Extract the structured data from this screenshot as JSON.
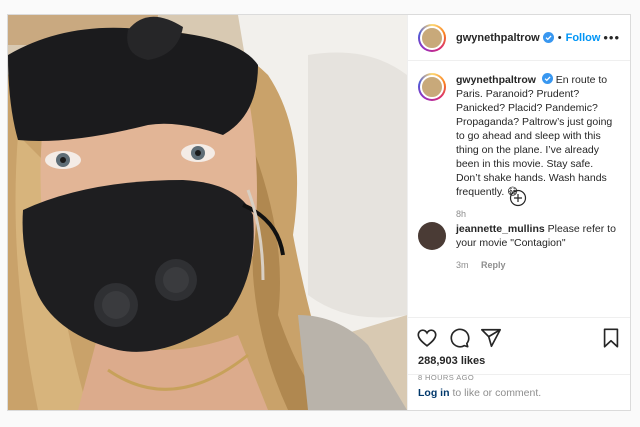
{
  "post": {
    "author": {
      "username": "gwynethpaltrow",
      "verified": true,
      "follow_label": "Follow",
      "separator": "•"
    },
    "caption": {
      "username": "gwynethpaltrow",
      "text": "En route to Paris. Paranoid? Prudent? Panicked? Placid? Pandemic? Propaganda? Paltrow’s just going to go ahead and sleep with this thing on the plane. I’ve already been in this movie. Stay safe. Don’t shake hands. Wash hands frequently. 😷",
      "time": "8h"
    },
    "comments": [
      {
        "username": "jeannette_mullins",
        "text": "Please refer to your movie \"Contagion\"",
        "time": "3m",
        "reply_label": "Reply"
      }
    ],
    "likes": "288,903 likes",
    "posted_ago": "8 HOURS AGO",
    "login_prompt": {
      "link": "Log in",
      "text": "to like or comment."
    }
  },
  "icons": {
    "more": "more-options-icon",
    "load_more": "plus-circle-icon",
    "like": "heart-icon",
    "comment": "comment-bubble-icon",
    "share": "paper-plane-icon",
    "save": "bookmark-icon",
    "verified": "verified-badge-icon"
  },
  "colors": {
    "accent": "#0095f6",
    "text": "#262626",
    "secondary": "#8e8e8e",
    "link": "#00376b",
    "border": "#dbdbdb"
  }
}
